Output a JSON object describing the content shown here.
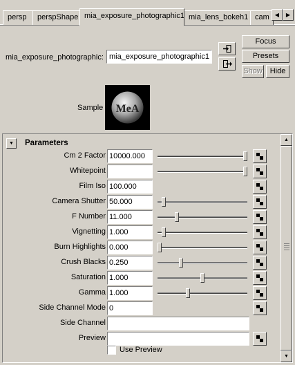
{
  "tabs": [
    {
      "label": "persp",
      "active": false
    },
    {
      "label": "perspShape",
      "active": false
    },
    {
      "label": "mia_exposure_photographic1",
      "active": true
    },
    {
      "label": "mia_lens_bokeh1",
      "active": false
    },
    {
      "label": "cam",
      "active": false
    }
  ],
  "header": {
    "node_type_label": "mia_exposure_photographic:",
    "node_name": "mia_exposure_photographic1",
    "focus_label": "Focus",
    "presets_label": "Presets",
    "show_label": "Show",
    "hide_label": "Hide",
    "sample_label": "Sample",
    "sample_logo": "MeA"
  },
  "parameters": {
    "title": "Parameters",
    "rows": [
      {
        "label": "Cm 2 Factor",
        "value": "10000.000",
        "slider": 1.0
      },
      {
        "label": "Whitepoint",
        "value": "",
        "slider": 1.0
      },
      {
        "label": "Film Iso",
        "value": "100.000",
        "slider": null
      },
      {
        "label": "Camera Shutter",
        "value": "50.000",
        "slider": 0.05
      },
      {
        "label": "F Number",
        "value": "11.000",
        "slider": 0.2
      },
      {
        "label": "Vignetting",
        "value": "1.000",
        "slider": 0.05
      },
      {
        "label": "Burn Highlights",
        "value": "0.000",
        "slider": 0.0
      },
      {
        "label": "Crush Blacks",
        "value": "0.250",
        "slider": 0.25
      },
      {
        "label": "Saturation",
        "value": "1.000",
        "slider": 0.5
      },
      {
        "label": "Gamma",
        "value": "1.000",
        "slider": 0.33
      },
      {
        "label": "Side Channel Mode",
        "value": "0",
        "slider": null
      }
    ],
    "side_channel": {
      "label": "Side Channel",
      "value": ""
    },
    "preview": {
      "label": "Preview",
      "value": ""
    },
    "use_preview": {
      "label": "Use Preview",
      "checked": false
    }
  }
}
